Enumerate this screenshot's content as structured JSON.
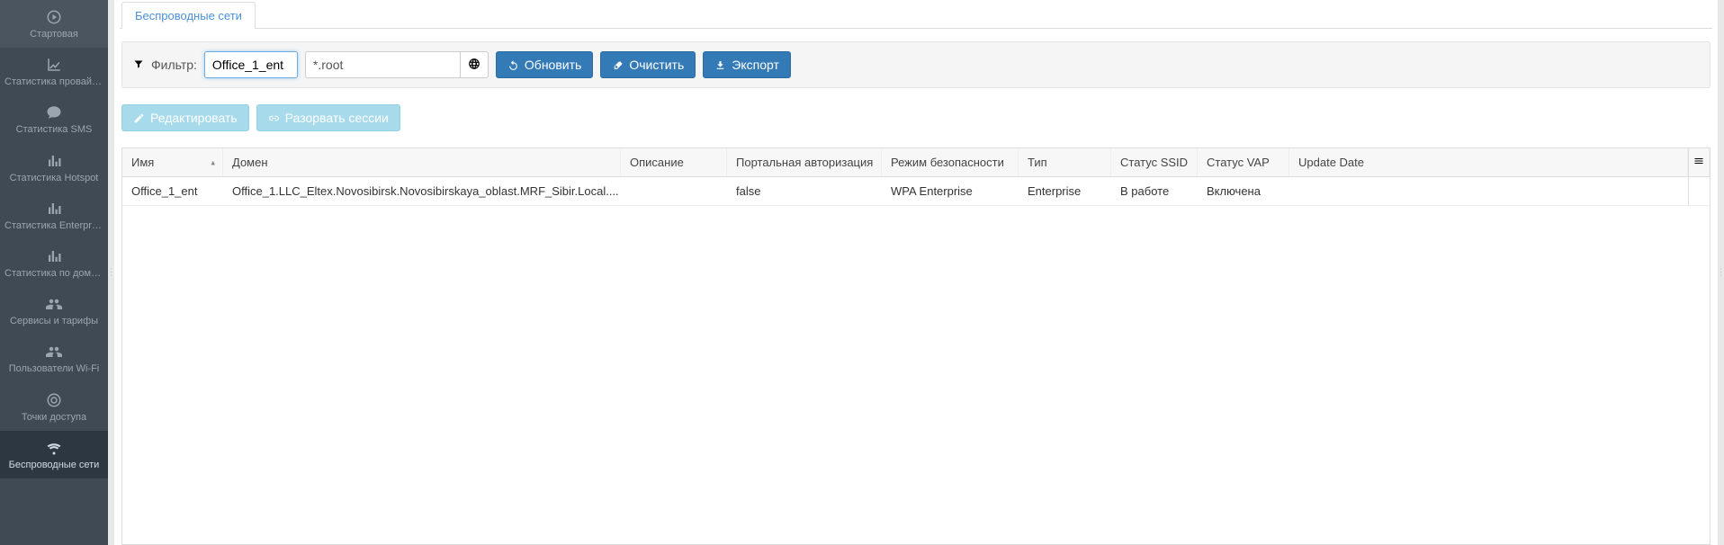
{
  "sidebar": {
    "items": [
      {
        "id": "home",
        "label": "Стартовая",
        "icon": "play-circle"
      },
      {
        "id": "prov-stats",
        "label": "Статистика провайде...",
        "icon": "line-chart"
      },
      {
        "id": "sms-stats",
        "label": "Статистика SMS",
        "icon": "comment"
      },
      {
        "id": "hotspot",
        "label": "Статистика Hotspot",
        "icon": "bar-chart"
      },
      {
        "id": "enterprise",
        "label": "Статистика Enterprise",
        "icon": "bar-chart"
      },
      {
        "id": "domain",
        "label": "Статистика по домену",
        "icon": "bar-chart"
      },
      {
        "id": "services",
        "label": "Сервисы и тарифы",
        "icon": "users"
      },
      {
        "id": "wifi-users",
        "label": "Пользователи Wi-Fi",
        "icon": "users"
      },
      {
        "id": "aps",
        "label": "Точки доступа",
        "icon": "bullseye"
      },
      {
        "id": "wireless",
        "label": "Беспроводные сети",
        "icon": "wifi",
        "active": true
      }
    ]
  },
  "tabs": {
    "active": "Беспроводные сети"
  },
  "toolbar": {
    "filter_label": "Фильтр:",
    "filter_value": "Office_1_ent",
    "domain_value": "*.root",
    "refresh": "Обновить",
    "clear": "Очистить",
    "export": "Экспорт"
  },
  "actions": {
    "edit": "Редактировать",
    "break_sessions": "Разорвать сессии"
  },
  "grid": {
    "headers": {
      "name": "Имя",
      "domain": "Домен",
      "description": "Описание",
      "portal_auth": "Портальная авторизация",
      "security_mode": "Режим безопасности",
      "type": "Тип",
      "ssid_status": "Статус SSID",
      "vap_status": "Статус VAP",
      "update_date": "Update Date"
    },
    "rows": [
      {
        "name": "Office_1_ent",
        "domain": "Office_1.LLC_Eltex.Novosibirsk.Novosibirskaya_oblast.MRF_Sibir.Local....",
        "description": "",
        "portal_auth": "false",
        "security_mode": "WPA Enterprise",
        "type": "Enterprise",
        "ssid_status": "В работе",
        "vap_status": "Включена",
        "update_date": ""
      }
    ]
  }
}
